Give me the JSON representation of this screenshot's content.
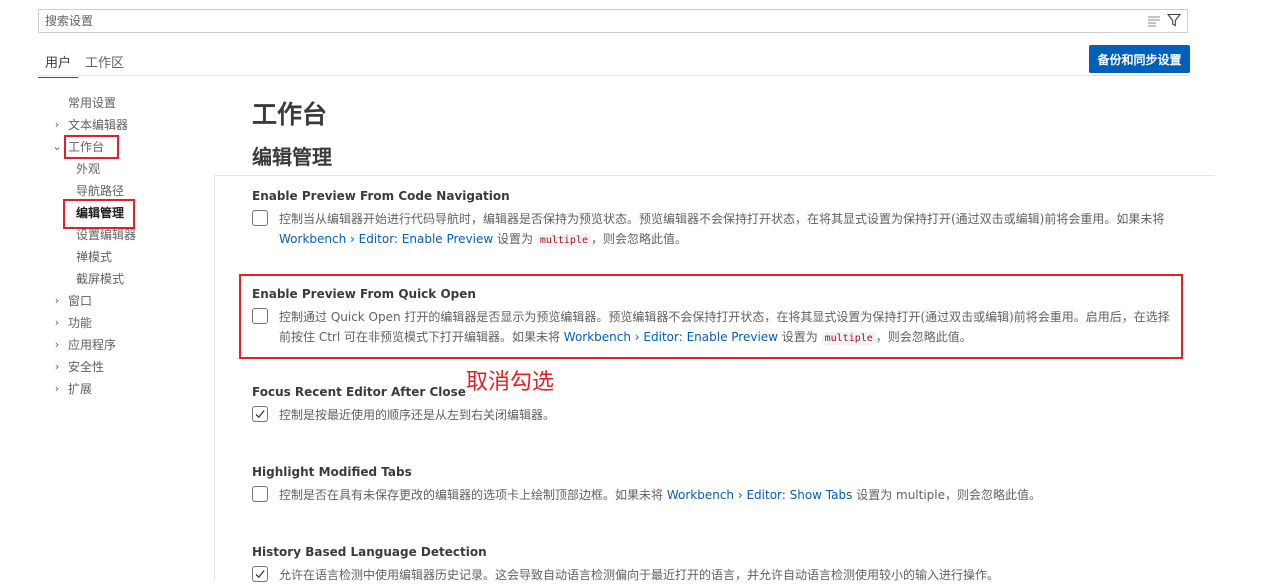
{
  "search": {
    "placeholder": "搜索设置"
  },
  "tabs": [
    {
      "label": "用户"
    },
    {
      "label": "工作区"
    }
  ],
  "sync_button": {
    "label": "备份和同步设置"
  },
  "toc": [
    {
      "label": "常用设置"
    },
    {
      "label": "文本编辑器"
    },
    {
      "label": "工作台"
    },
    {
      "label": "外观"
    },
    {
      "label": "导航路径"
    },
    {
      "label": "编辑管理"
    },
    {
      "label": "设置编辑器"
    },
    {
      "label": "禅模式"
    },
    {
      "label": "截屏模式"
    },
    {
      "label": "窗口"
    },
    {
      "label": "功能"
    },
    {
      "label": "应用程序"
    },
    {
      "label": "安全性"
    },
    {
      "label": "扩展"
    }
  ],
  "main": {
    "title": "工作台",
    "section": "编辑管理",
    "settings": [
      {
        "title": "Enable Preview From Code Navigation",
        "checked": false,
        "desc_before": "控制当从编辑器开始进行代码导航时，编辑器是否保持为预览状态。预览编辑器不会保持打开状态，在将其显式设置为保持打开(通过双击或编辑)前将会重用。如果未将 ",
        "link": "Workbench › Editor: Enable Preview",
        "desc_mid": " 设置为 ",
        "code": "multiple",
        "desc_after": "，则会忽略此值。"
      },
      {
        "title": "Enable Preview From Quick Open",
        "checked": false,
        "desc_before": "控制通过 Quick Open 打开的编辑器是否显示为预览编辑器。预览编辑器不会保持打开状态，在将其显式设置为保持打开(通过双击或编辑)前将会重用。启用后，在选择前按住 Ctrl 可在非预览模式下打开编辑器。如果未将 ",
        "link": "Workbench › Editor: Enable Preview",
        "desc_mid": " 设置为 ",
        "code": "multiple",
        "desc_after": "，则会忽略此值。"
      },
      {
        "title": "Focus Recent Editor After Close",
        "checked": true,
        "desc_before": "控制是按最近使用的顺序还是从左到右关闭编辑器。"
      },
      {
        "title": "Highlight Modified Tabs",
        "checked": false,
        "desc_before": "控制是否在具有未保存更改的编辑器的选项卡上绘制顶部边框。如果未将 ",
        "link": "Workbench › Editor: Show Tabs",
        "desc_mid": " 设置为 multiple，则会忽略此值。"
      },
      {
        "title": "History Based Language Detection",
        "checked": true,
        "desc_before": "允许在语言检测中使用编辑器历史记录。这会导致自动语言检测偏向于最近打开的语言，并允许自动语言检测使用较小的输入进行操作。"
      }
    ]
  },
  "annotation": {
    "text": "取消勾选"
  },
  "colors": {
    "accent": "#005fb8",
    "annotation_red": "#e0202a",
    "link": "#005fb8"
  }
}
